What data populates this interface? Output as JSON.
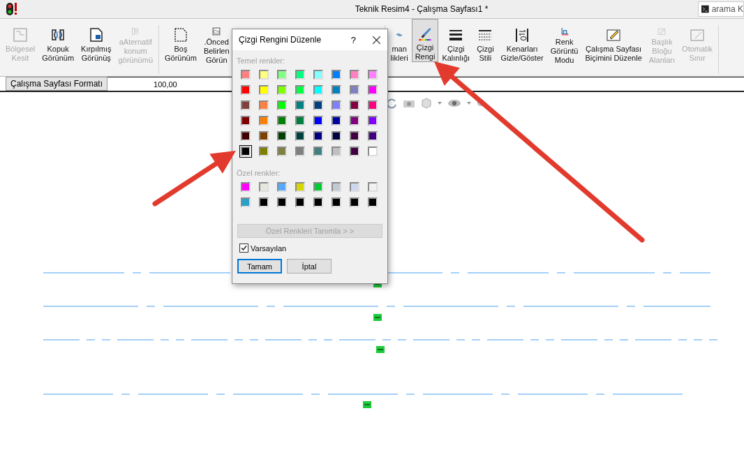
{
  "window": {
    "title": "Teknik Resim4 - Çalışma Sayfası1 *"
  },
  "search": {
    "value": "arama K"
  },
  "ribbon": {
    "groups": [
      {
        "items": [
          {
            "label": "Bölgesel\nKesit",
            "disabled": true,
            "selected": false
          },
          {
            "label": "Kopuk\nGörünüm",
            "disabled": false,
            "selected": false
          },
          {
            "label": "Kırpılmış\nGörünüş",
            "disabled": false,
            "selected": false
          },
          {
            "label": "aAternatif\nkonum\ngörünümü",
            "disabled": true,
            "selected": false
          }
        ]
      },
      {
        "items": [
          {
            "label": "Boş\nGörünüm",
            "disabled": false,
            "selected": false
          },
          {
            "label": ".Önced\nBelirlen\nGörün",
            "disabled": false,
            "selected": false
          }
        ]
      },
      {
        "items": [
          {
            "label": "man\nlikleri",
            "disabled": false,
            "selected": false
          },
          {
            "label": "Çizgi\nRengi",
            "disabled": false,
            "selected": true
          },
          {
            "label": "Çizgi\nKalınlığı",
            "disabled": false,
            "selected": false
          },
          {
            "label": "Çizgi\nStili",
            "disabled": false,
            "selected": false
          },
          {
            "label": "Kenarları\nGizle/Göster",
            "disabled": false,
            "selected": false
          },
          {
            "label": "Renk\nGörüntü\nModu",
            "disabled": false,
            "selected": false
          },
          {
            "label": "Çalışma Sayfası\nBiçimini Düzenle",
            "disabled": false,
            "selected": false
          },
          {
            "label": "Başlık\nBloğu\nAlanları",
            "disabled": true,
            "selected": false
          },
          {
            "label": "Otomatik\nSınır",
            "disabled": true,
            "selected": false
          }
        ]
      }
    ]
  },
  "format_bar": {
    "tab": "Çalışma Sayfası Formatı",
    "value": "100,00"
  },
  "dialog": {
    "title": "Çizgi Rengini Düzenle",
    "help": "?",
    "basic_label": "Temel renkler:",
    "basic_colors": [
      {
        "color": "#ff8080",
        "selected": false
      },
      {
        "color": "#ffff80",
        "selected": false
      },
      {
        "color": "#80ff80",
        "selected": false
      },
      {
        "color": "#00ff80",
        "selected": false
      },
      {
        "color": "#80ffff",
        "selected": false
      },
      {
        "color": "#0080ff",
        "selected": false
      },
      {
        "color": "#ff80c0",
        "selected": false
      },
      {
        "color": "#ff80ff",
        "selected": false
      },
      {
        "color": "#ff0000",
        "selected": false
      },
      {
        "color": "#ffff00",
        "selected": false
      },
      {
        "color": "#80ff00",
        "selected": false
      },
      {
        "color": "#00ff40",
        "selected": false
      },
      {
        "color": "#00ffff",
        "selected": false
      },
      {
        "color": "#0080c0",
        "selected": false
      },
      {
        "color": "#8080c0",
        "selected": false
      },
      {
        "color": "#ff00ff",
        "selected": false
      },
      {
        "color": "#804040",
        "selected": false
      },
      {
        "color": "#ff8040",
        "selected": false
      },
      {
        "color": "#00ff00",
        "selected": false
      },
      {
        "color": "#008080",
        "selected": false
      },
      {
        "color": "#004080",
        "selected": false
      },
      {
        "color": "#8080ff",
        "selected": false
      },
      {
        "color": "#800040",
        "selected": false
      },
      {
        "color": "#ff0080",
        "selected": false
      },
      {
        "color": "#800000",
        "selected": false
      },
      {
        "color": "#ff8000",
        "selected": false
      },
      {
        "color": "#008000",
        "selected": false
      },
      {
        "color": "#008040",
        "selected": false
      },
      {
        "color": "#0000ff",
        "selected": false
      },
      {
        "color": "#0000a0",
        "selected": false
      },
      {
        "color": "#800080",
        "selected": false
      },
      {
        "color": "#8000ff",
        "selected": false
      },
      {
        "color": "#400000",
        "selected": false
      },
      {
        "color": "#804000",
        "selected": false
      },
      {
        "color": "#004000",
        "selected": false
      },
      {
        "color": "#004040",
        "selected": false
      },
      {
        "color": "#000080",
        "selected": false
      },
      {
        "color": "#000040",
        "selected": false
      },
      {
        "color": "#400040",
        "selected": false
      },
      {
        "color": "#400080",
        "selected": false
      },
      {
        "color": "#000000",
        "selected": true
      },
      {
        "color": "#808000",
        "selected": false
      },
      {
        "color": "#808040",
        "selected": false
      },
      {
        "color": "#808080",
        "selected": false
      },
      {
        "color": "#408080",
        "selected": false
      },
      {
        "color": "#c0c0c0",
        "selected": false
      },
      {
        "color": "#400040",
        "selected": false
      },
      {
        "color": "#ffffff",
        "selected": false
      }
    ],
    "custom_label": "Özel renkler:",
    "custom_colors": [
      {
        "color": "#ff00ff",
        "selected": false
      },
      {
        "color": "#e6e6dc",
        "selected": false
      },
      {
        "color": "#55aaff",
        "selected": false
      },
      {
        "color": "#d7d700",
        "selected": false
      },
      {
        "color": "#00cc33",
        "selected": false
      },
      {
        "color": "#c3c8d2",
        "selected": false
      },
      {
        "color": "#cdd7f0",
        "selected": false
      },
      {
        "color": "#f0f0f0",
        "selected": false
      },
      {
        "color": "#28a0c8",
        "selected": false
      },
      {
        "color": "#000000",
        "selected": false
      },
      {
        "color": "#000000",
        "selected": false
      },
      {
        "color": "#000000",
        "selected": false
      },
      {
        "color": "#000000",
        "selected": false
      },
      {
        "color": "#000000",
        "selected": false
      },
      {
        "color": "#000000",
        "selected": false
      },
      {
        "color": "#000000",
        "selected": false
      }
    ],
    "define_button": {
      "label": "Özel Renkleri Tanımla > >",
      "disabled": true
    },
    "default_checkbox": {
      "label": "Varsayılan",
      "checked": true
    },
    "buttons": [
      {
        "label": "Tamam",
        "default": true
      },
      {
        "label": "İptal",
        "default": false
      }
    ]
  }
}
